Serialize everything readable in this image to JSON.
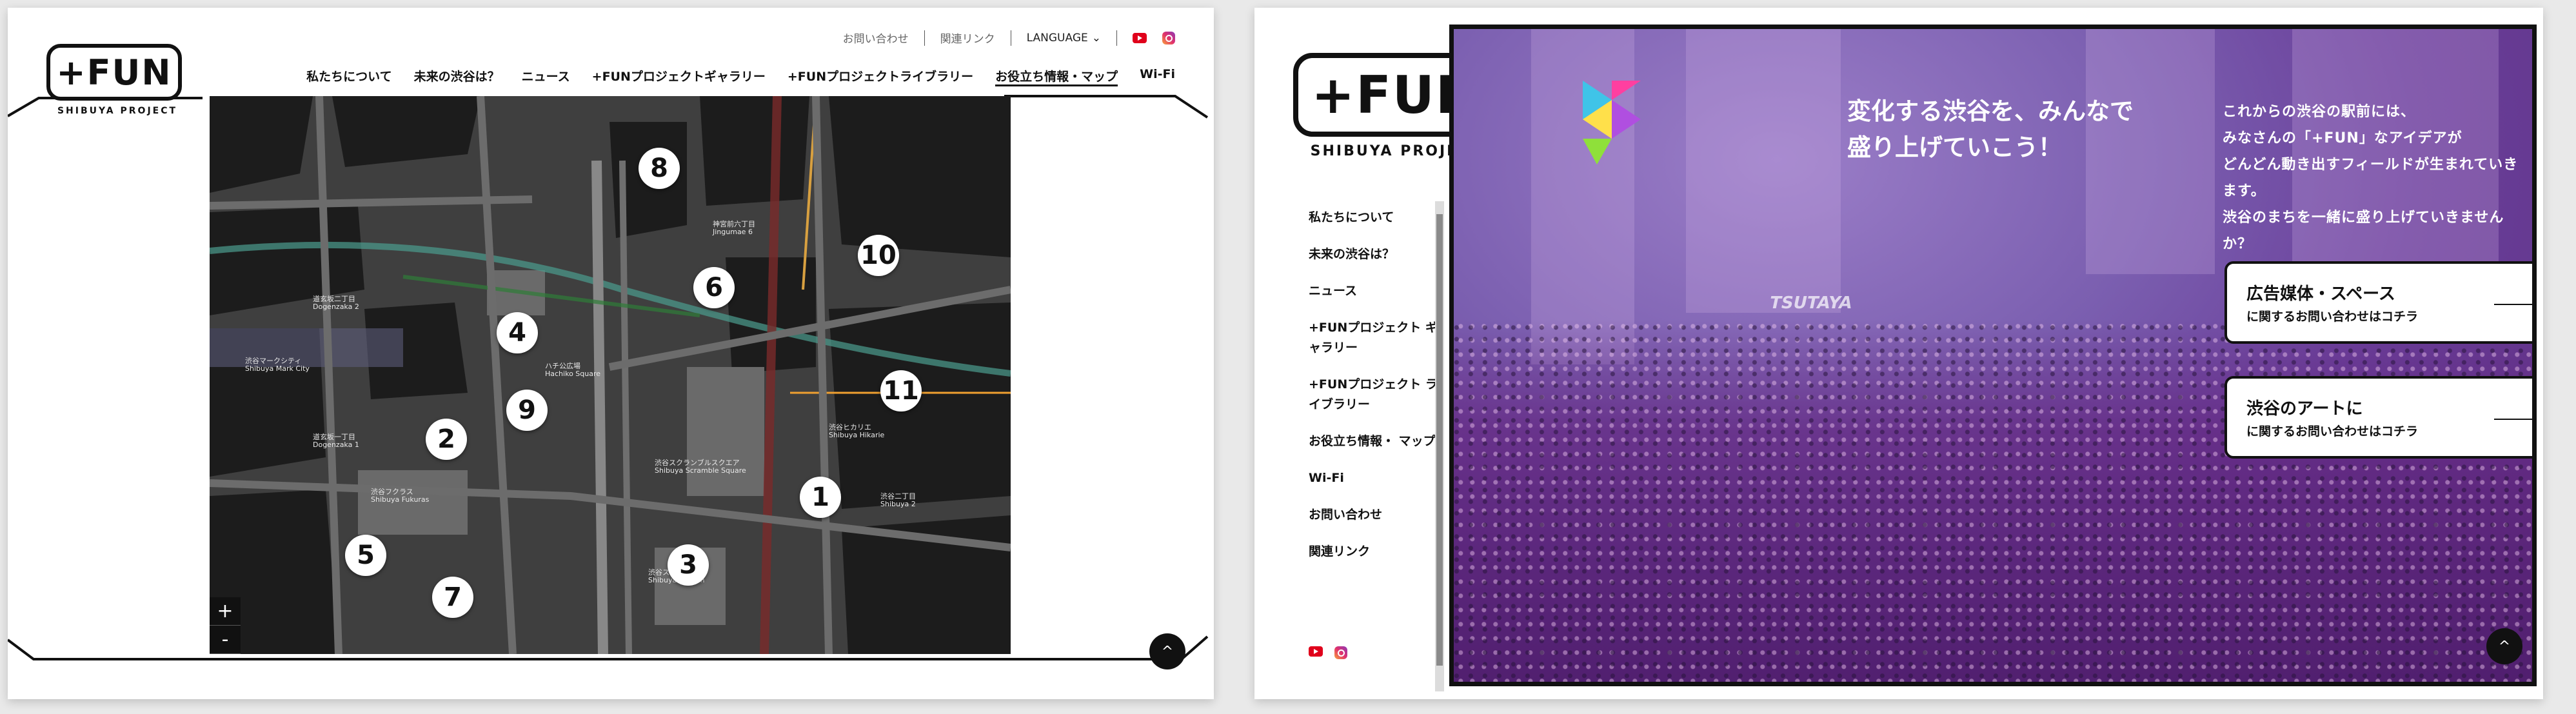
{
  "left": {
    "logo": {
      "main": "+FUN",
      "sub": "SHIBUYA PROJECT"
    },
    "utility_nav": {
      "contact": "お問い合わせ",
      "links": "関連リンク",
      "language": "LANGUAGE"
    },
    "main_nav": [
      "私たちについて",
      "未来の渋谷は？",
      "ニュース",
      "+FUNプロジェクトギャラリー",
      "+FUNプロジェクトライブラリー",
      "お役立ち情報・マップ",
      "Wi-Fi"
    ],
    "map": {
      "markers": [
        "1",
        "2",
        "3",
        "4",
        "5",
        "6",
        "7",
        "8",
        "9",
        "10",
        "11"
      ],
      "labels": [
        "渋谷マークシティ",
        "Shibuya Mark City",
        "道玄坂二丁目",
        "Dogenzaka 2",
        "道玄坂一丁目",
        "Dogenzaka 1",
        "渋谷スクランブルスクエア",
        "Shibuya Scramble Square",
        "渋谷ヒカリエ",
        "Shibuya Hikarie",
        "渋谷二丁目",
        "Shibuya 2",
        "神宮前六丁目",
        "Jingumae 6",
        "渋谷フクラス",
        "Shibuya Fukuras",
        "渋谷ストリーム",
        "Shibuya Stream",
        "ハチ公広場",
        "Hachiko Square"
      ],
      "zoom_in": "+",
      "zoom_out": "-"
    },
    "back_to_top": "^"
  },
  "right": {
    "logo": {
      "main": "+FUN",
      "sub": "SHIBUYA PROJECT"
    },
    "side_nav": [
      "私たちについて",
      "未来の渋谷は？",
      "ニュース",
      "+FUNプロジェクト ギャラリー",
      "+FUNプロジェクト ライブラリー",
      "お役立ち情報・ マップ",
      "Wi-Fi",
      "お問い合わせ",
      "関連リンク"
    ],
    "tagline": [
      "変化する渋谷を、みんなで",
      "盛り上げていこう！"
    ],
    "description": [
      "これからの渋谷の駅前には、",
      "みなさんの「+FUN」なアイデアが",
      "どんどん動き出すフィールドが生まれていきます。",
      "渋谷のまちを一緒に盛り上げていきませんか？"
    ],
    "cta": [
      {
        "main": "広告媒体・スペース",
        "sub": "に関するお問い合わせはコチラ"
      },
      {
        "main": "渋谷のアートに",
        "sub": "に関するお問い合わせはコチラ"
      }
    ],
    "hero_sign": "TSUTAYA",
    "back_to_top": "^"
  },
  "colors": {
    "youtube": "#e0001b",
    "instagram": "#e1306c",
    "frame": "#111111",
    "hero_tint": "#7b5fb0"
  },
  "icons": [
    "youtube-icon",
    "instagram-icon",
    "chevron-down-icon",
    "chevron-up-icon",
    "arrow-right-icon",
    "plus-icon",
    "minus-icon"
  ]
}
